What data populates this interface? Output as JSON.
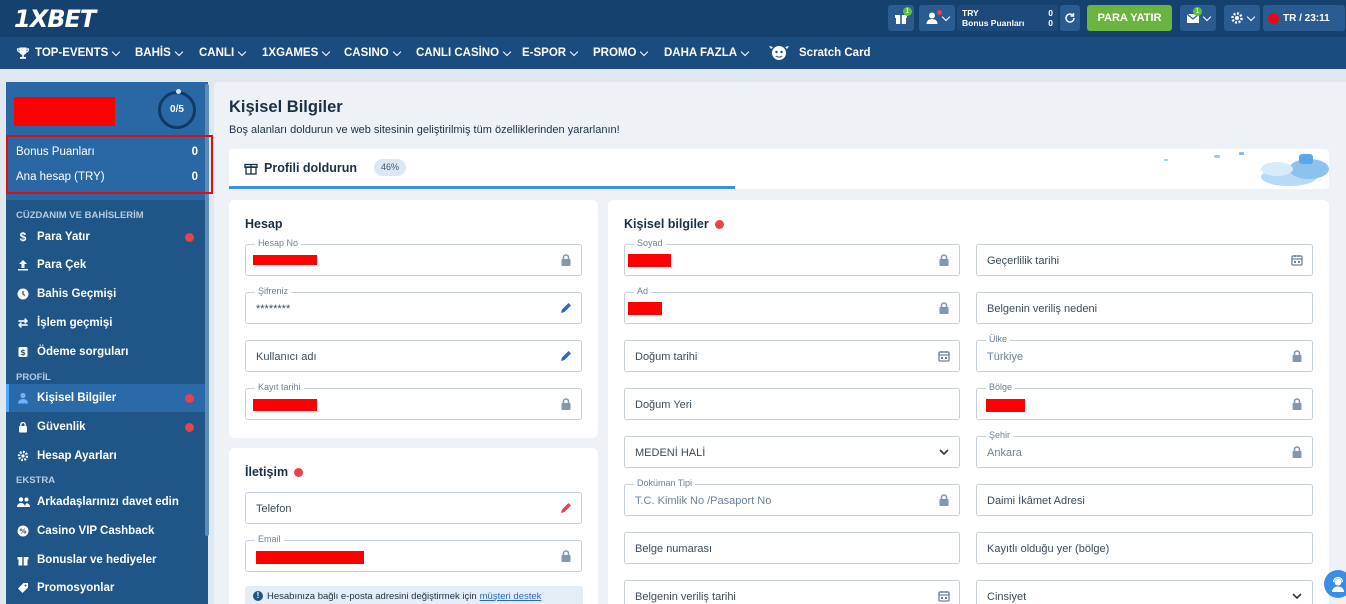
{
  "header": {
    "logo": "1XBET",
    "account": {
      "currency": "TRY",
      "bonus_label": "Bonus Puanları",
      "value1": "0",
      "value2": "0"
    },
    "deposit_button": "PARA YATIR",
    "lang_time": "TR / 23:11",
    "gift_badge": "1",
    "mail_badge": "1"
  },
  "nav": [
    {
      "label": "TOP-EVENTS"
    },
    {
      "label": "BAHİS"
    },
    {
      "label": "CANLI"
    },
    {
      "label": "1XGAMES"
    },
    {
      "label": "CASINO"
    },
    {
      "label": "CANLI CASİNO"
    },
    {
      "label": "E-SPOR"
    },
    {
      "label": "PROMO"
    },
    {
      "label": "DAHA FAZLA"
    },
    {
      "label": "Scratch Card"
    }
  ],
  "sidebar": {
    "progress": "0/5",
    "balances": [
      {
        "label": "Bonus Puanları",
        "value": "0"
      },
      {
        "label": "Ana hesap (TRY)",
        "value": "0"
      }
    ],
    "sections": {
      "wallet": "CÜZDANIM VE BAHİSLERİM",
      "profile": "PROFİL",
      "extra": "EKSTRA"
    },
    "items": [
      {
        "label": "Para Yatır",
        "icon": "dollar-icon"
      },
      {
        "label": "Para Çek",
        "icon": "upload-icon"
      },
      {
        "label": "Bahis Geçmişi",
        "icon": "clock-icon"
      },
      {
        "label": "İşlem geçmişi",
        "icon": "arrows-icon"
      },
      {
        "label": "Ödeme sorguları",
        "icon": "receipt-icon"
      },
      {
        "label": "Kişisel Bilgiler",
        "icon": "user-icon"
      },
      {
        "label": "Güvenlik",
        "icon": "lock-icon"
      },
      {
        "label": "Hesap Ayarları",
        "icon": "gear-icon"
      },
      {
        "label": "Arkadaşlarınızı davet edin",
        "icon": "users-icon"
      },
      {
        "label": "Casino VIP Cashback",
        "icon": "percent-icon"
      },
      {
        "label": "Bonuslar ve hediyeler",
        "icon": "gift-icon"
      },
      {
        "label": "Promosyonlar",
        "icon": "tag-icon"
      }
    ]
  },
  "main": {
    "title": "Kişisel Bilgiler",
    "subtitle": "Boş alanları doldurun ve web sitesinin geliştirilmiş tüm özelliklerinden yararlanın!",
    "progress_title": "Profili doldurun",
    "progress_percent": "46%",
    "progress_fraction": 0.46,
    "hesap": {
      "title": "Hesap",
      "account_no_label": "Hesap No",
      "password_label": "Şifreniz",
      "password_value": "********",
      "username_placeholder": "Kullanıcı adı",
      "reg_date_label": "Kayıt tarihi"
    },
    "iletisim": {
      "title": "İletişim",
      "phone_placeholder": "Telefon",
      "email_label": "Email",
      "info_text": "Hesabınıza bağlı e-posta adresini değiştirmek için",
      "info_link": "müşteri destek"
    },
    "personal": {
      "title": "Kişisel bilgiler",
      "surname_label": "Soyad",
      "name_label": "Ad",
      "birth_date": "Doğum tarihi",
      "birth_place": "Doğum Yeri",
      "marital": "MEDENİ HALİ",
      "doc_type_label": "Doküman Tipi",
      "doc_type_value": "T.C. Kimlik No /Pasaport No",
      "doc_number": "Belge numarası",
      "doc_issue_date": "Belgenin veriliş tarihi",
      "validity_date": "Geçerlilik tarihi",
      "issue_reason": "Belgenin veriliş nedeni",
      "country_label": "Ülke",
      "country_value": "Türkiye",
      "region_label": "Bölge",
      "city_label": "Şehir",
      "city_value": "Ankara",
      "address": "Daimi İkâmet Adresi",
      "registered_place": "Kayıtlı olduğu yer (bölge)",
      "gender": "Cinsiyet"
    }
  }
}
